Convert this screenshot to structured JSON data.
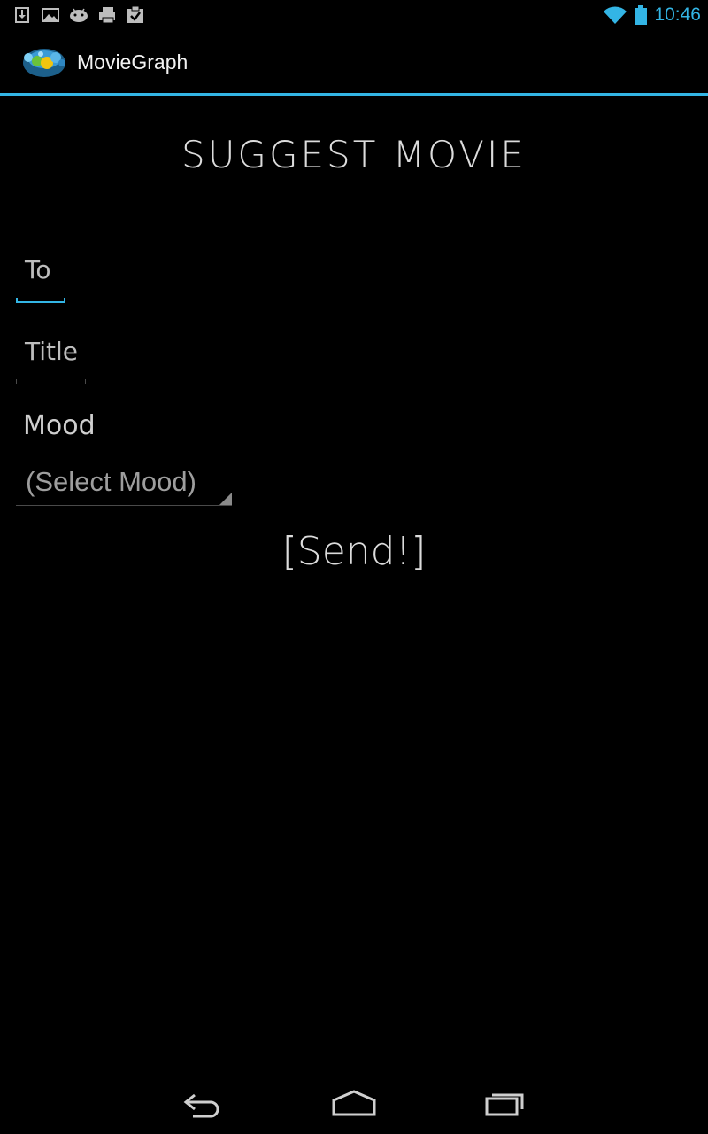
{
  "status_bar": {
    "time": "10:46",
    "notification_icons": [
      "download-icon",
      "image-icon",
      "android-icon",
      "printer-icon",
      "clipboard-check-icon"
    ],
    "wifi_icon": "wifi-icon",
    "battery_icon": "battery-icon",
    "accent_color": "#33b5e5"
  },
  "action_bar": {
    "app_title": "MovieGraph",
    "logo_icon": "moviegraph-logo-icon"
  },
  "main": {
    "heading": "SUGGEST MOVIE",
    "to_field": {
      "placeholder": "To",
      "value": ""
    },
    "title_field": {
      "placeholder": "Title",
      "value": ""
    },
    "mood_label": "Mood",
    "mood_spinner": {
      "selected": "(Select Mood)"
    },
    "send_label": "[Send!]"
  },
  "nav_bar": {
    "back_icon": "back-icon",
    "home_icon": "home-icon",
    "recents_icon": "recent-apps-icon"
  }
}
